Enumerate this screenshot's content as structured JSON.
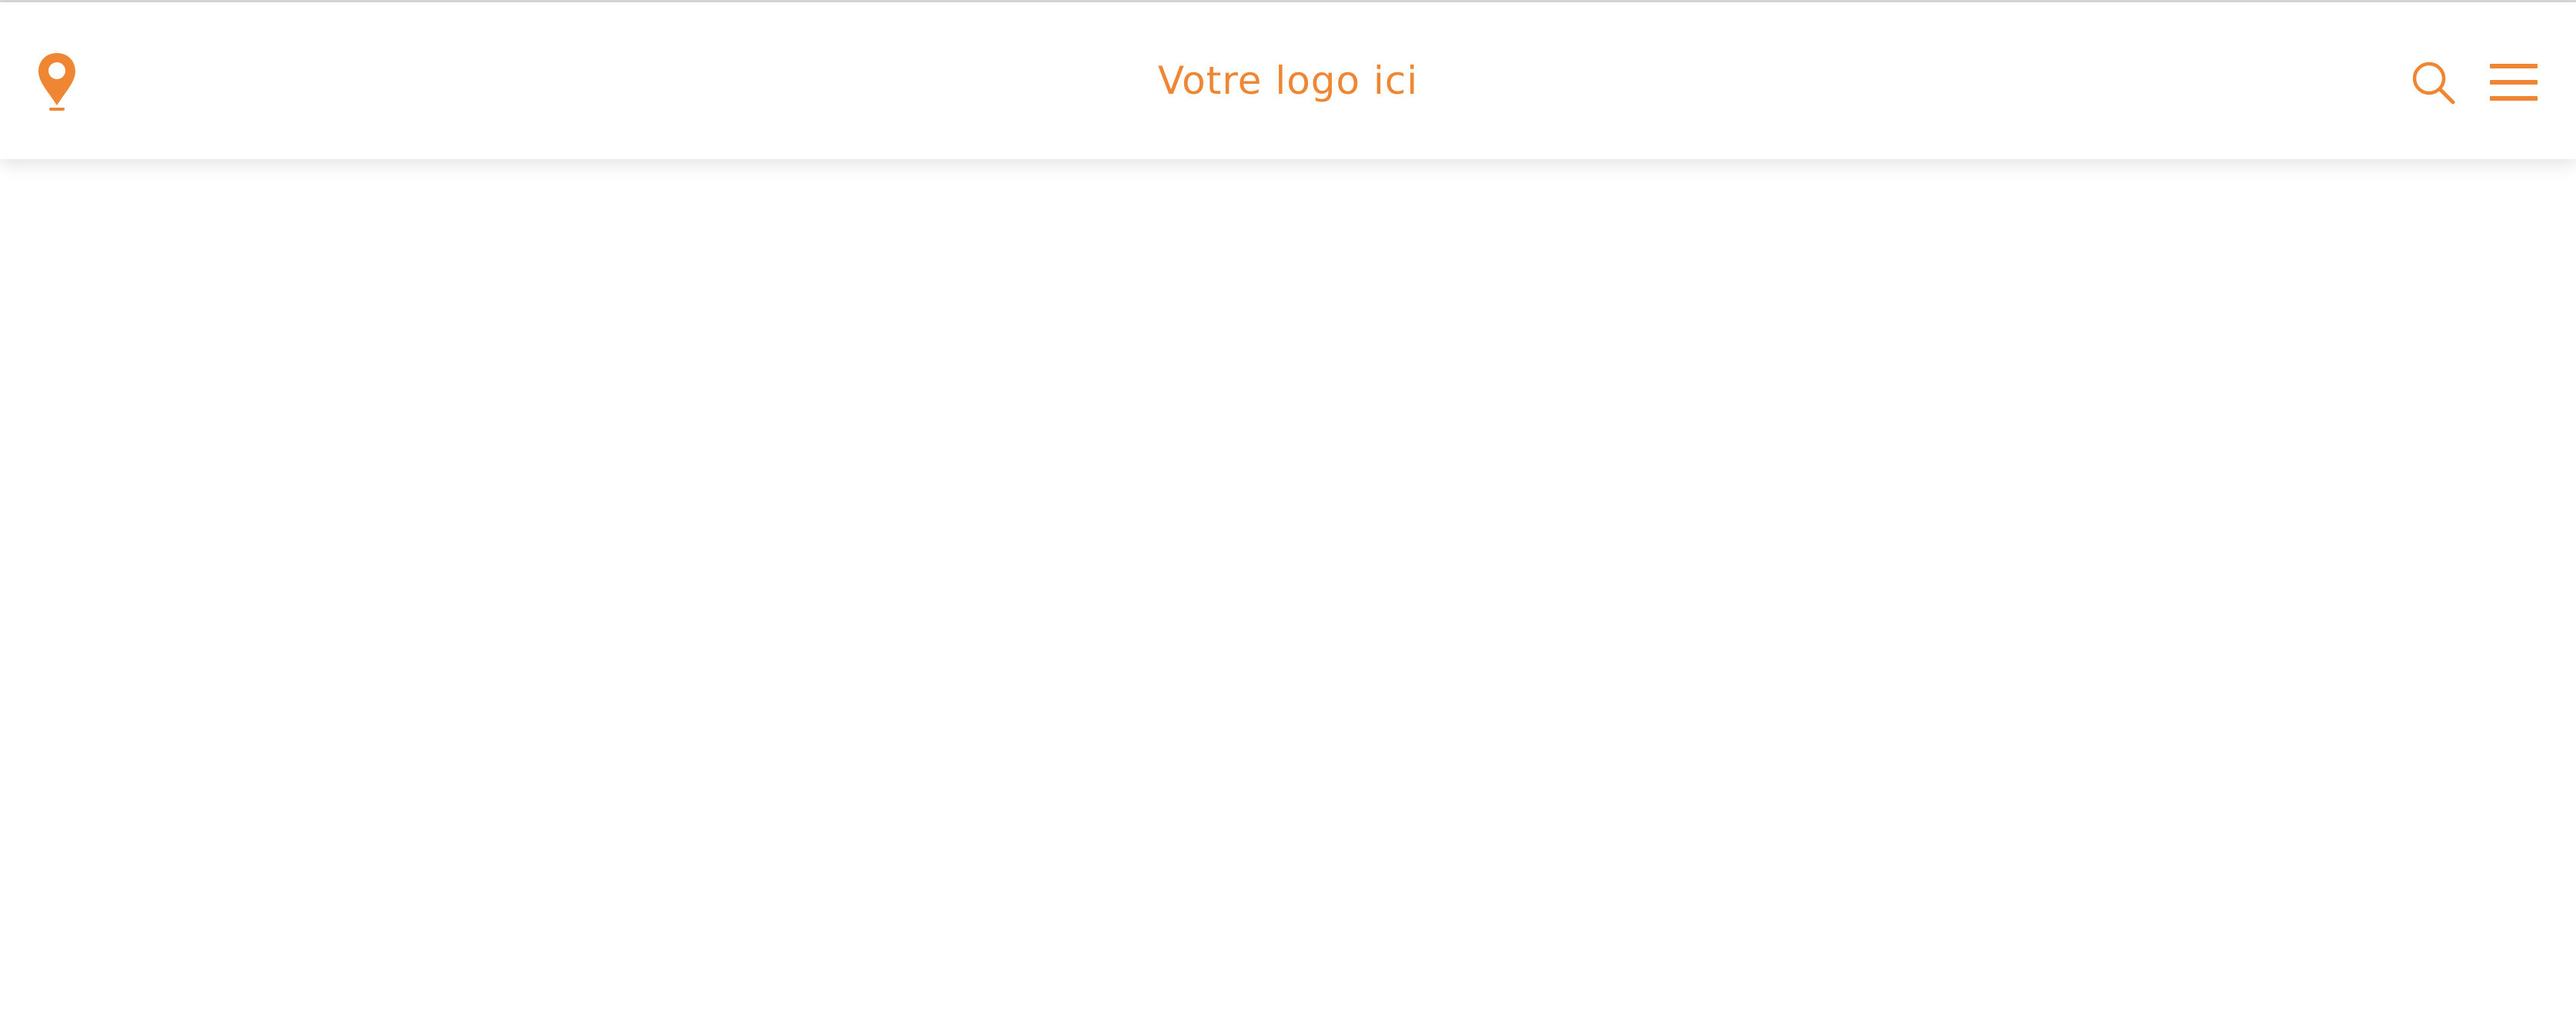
{
  "theme": {
    "accent": "#ee8633"
  },
  "header": {
    "logo_text": "Votre logo ici",
    "location_icon": "map-pin-icon",
    "search_icon": "search-icon",
    "menu_icon": "hamburger-menu-icon"
  }
}
